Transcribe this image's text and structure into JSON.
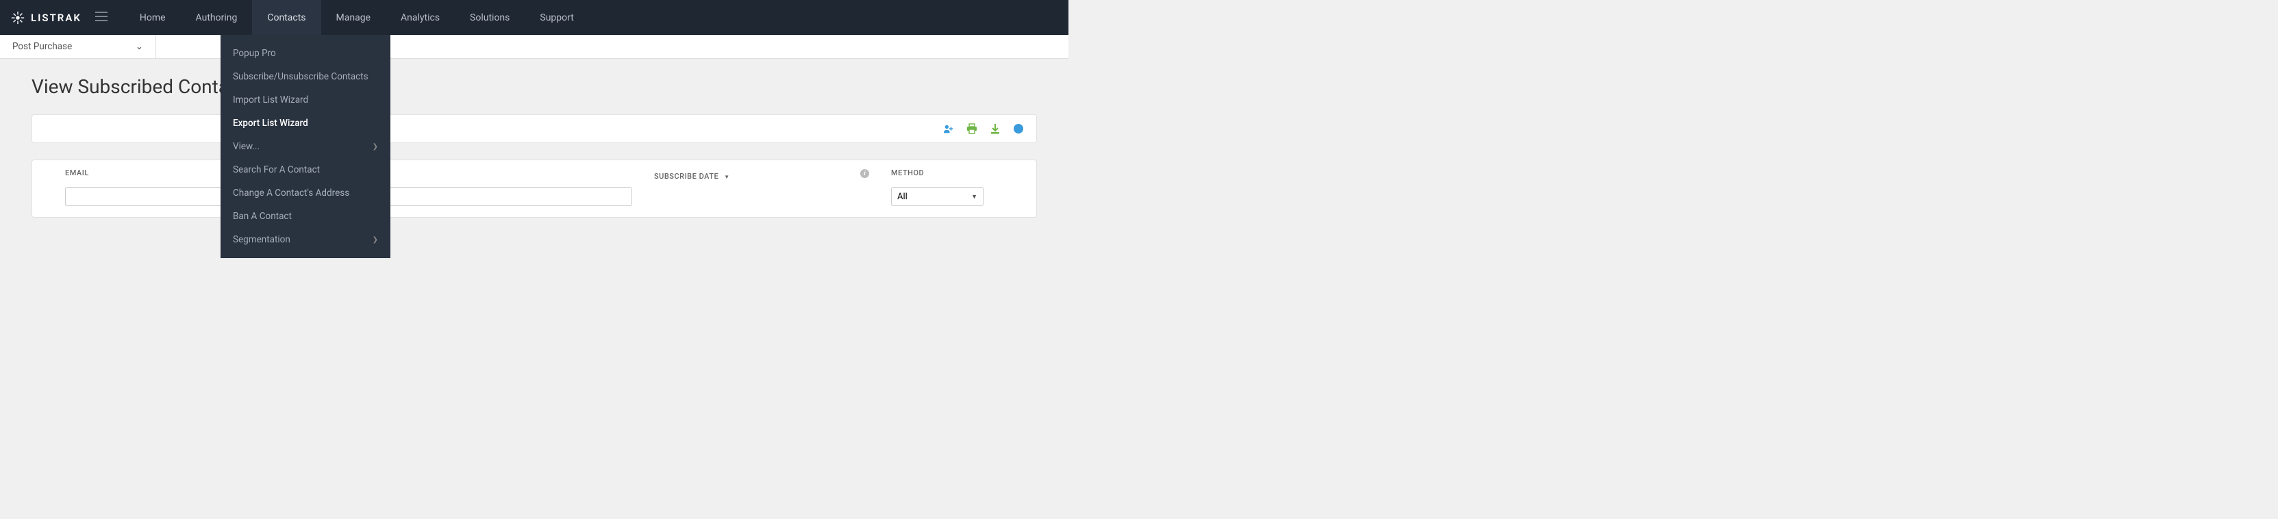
{
  "brand": "LISTRAK",
  "nav": {
    "items": [
      "Home",
      "Authoring",
      "Contacts",
      "Manage",
      "Analytics",
      "Solutions",
      "Support"
    ],
    "activeIndex": 2
  },
  "listSelector": {
    "value": "Post Purchase"
  },
  "pageTitle": "View Subscribed Contacts",
  "dropdown": {
    "items": [
      {
        "label": "Popup Pro",
        "submenu": false
      },
      {
        "label": "Subscribe/Unsubscribe Contacts",
        "submenu": false
      },
      {
        "label": "Import List Wizard",
        "submenu": false
      },
      {
        "label": "Export List Wizard",
        "submenu": false,
        "highlight": true
      },
      {
        "label": "View...",
        "submenu": true
      },
      {
        "label": "Search For A Contact",
        "submenu": false
      },
      {
        "label": "Change A Contact's Address",
        "submenu": false
      },
      {
        "label": "Ban A Contact",
        "submenu": false
      },
      {
        "label": "Segmentation",
        "submenu": true
      }
    ]
  },
  "table": {
    "columns": {
      "email": "EMAIL",
      "subscribeDate": "SUBSCRIBE DATE",
      "method": "METHOD"
    },
    "methodFilter": {
      "value": "All"
    }
  },
  "toolbarIcons": [
    "add-contact-icon",
    "print-icon",
    "download-icon",
    "info-icon"
  ],
  "colors": {
    "accentBlue": "#3a9bdc",
    "accentGreen": "#6fb544"
  }
}
